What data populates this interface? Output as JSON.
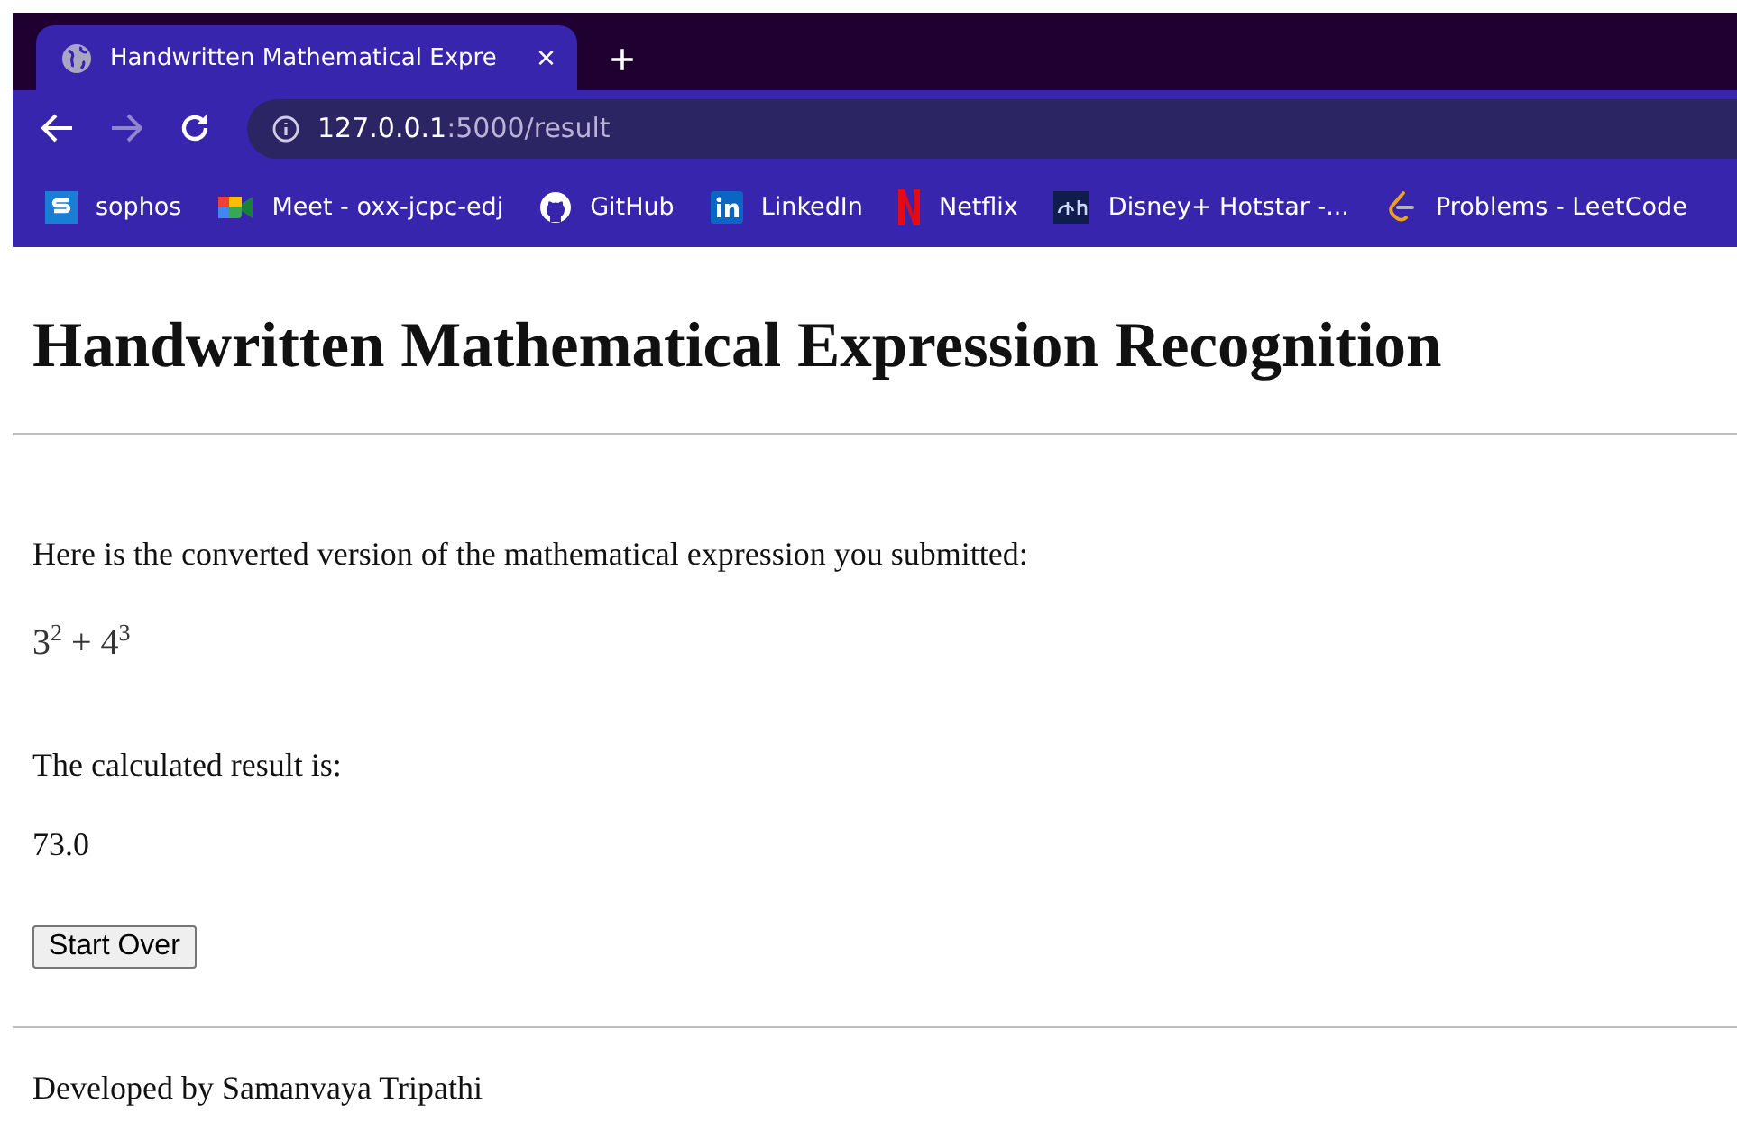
{
  "tab": {
    "title": "Handwritten Mathematical Expre",
    "close": "×",
    "new_tab": "+"
  },
  "address_bar": {
    "host": "127.0.0.1",
    "path": ":5000/result"
  },
  "bookmarks": [
    {
      "label": "sophos"
    },
    {
      "label": "Meet - oxx-jcpc-edj"
    },
    {
      "label": "GitHub"
    },
    {
      "label": "LinkedIn"
    },
    {
      "label": "Netflix"
    },
    {
      "label": "Disney+ Hotstar -..."
    },
    {
      "label": "Problems - LeetCode"
    }
  ],
  "page": {
    "heading": "Handwritten Mathematical Expression Recognition",
    "intro": "Here is the converted version of the mathematical expression you submitted:",
    "expression": "3$^{2}$ + 4$^{3}$",
    "result_label": "The calculated result is:",
    "result": "73.0",
    "button": "Start Over",
    "footer": "Developed by Samanvaya Tripathi"
  }
}
